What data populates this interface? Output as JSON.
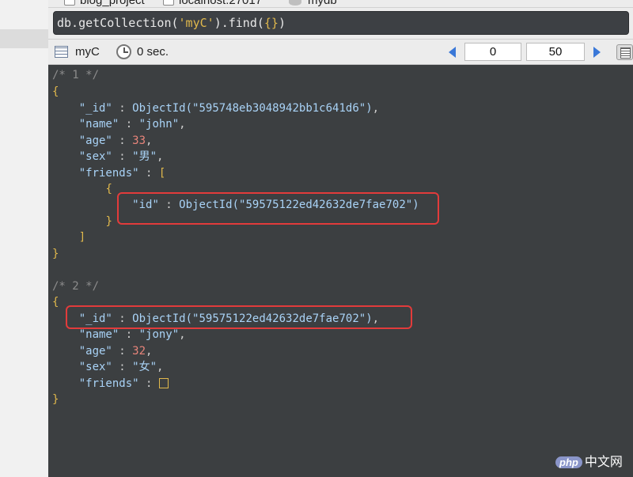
{
  "crumbs": [
    "blog_project",
    "localhost:27017",
    "mydb"
  ],
  "query": {
    "prefix": "db.getCollection(",
    "collection_arg": "'myC'",
    "mid": ").find(",
    "braces": "{}",
    "suffix": ")"
  },
  "toolbar": {
    "collection_name": "myC",
    "time": "0 sec.",
    "skip": "0",
    "limit": "50"
  },
  "documents": [
    {
      "comment": "/* 1 */",
      "fields": {
        "_id": "\"595748eb3048942bb1c641d6\"",
        "name": "\"john\"",
        "age": "33",
        "sex": "\"男\"",
        "friend_id": "\"59575122ed42632de7fae702\""
      }
    },
    {
      "comment": "/* 2 */",
      "fields": {
        "_id": "\"59575122ed42632de7fae702\"",
        "name": "\"jony\"",
        "age": "32",
        "sex": "\"女\""
      }
    }
  ],
  "labels": {
    "open_brace": "{",
    "close_brace": "}",
    "open_bracket": "[",
    "close_bracket": "]",
    "key_id": "\"_id\"",
    "key_name": "\"name\"",
    "key_age": "\"age\"",
    "key_sex": "\"sex\"",
    "key_friends": "\"friends\"",
    "key_friend_id": "\"id\"",
    "colon": " : ",
    "comma": ",",
    "objectid": "ObjectId(",
    "close_paren": ")"
  },
  "watermark": {
    "logo": "php",
    "text": "中文网"
  },
  "colors": {
    "editor_bg": "#3c3f41",
    "highlight": "#e23b3b",
    "accent_blue": "#3a78d8"
  }
}
